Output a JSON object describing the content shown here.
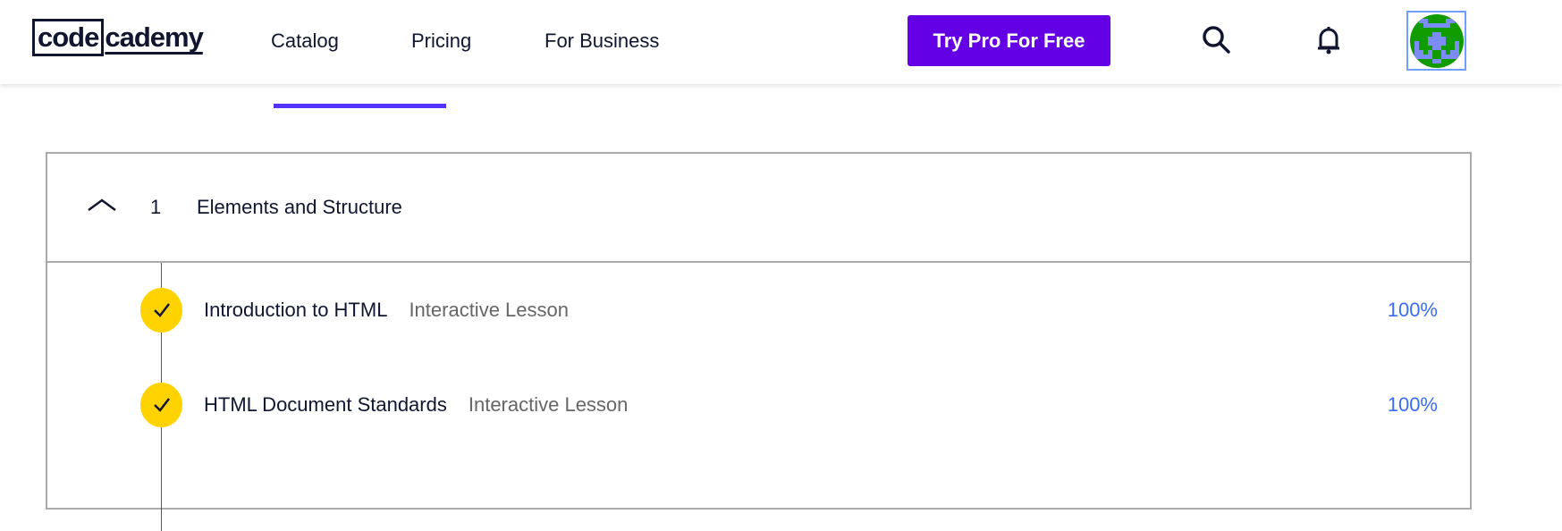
{
  "header": {
    "logo": {
      "part1": "code",
      "part2": "cademy"
    },
    "nav": [
      {
        "label": "Catalog"
      },
      {
        "label": "Pricing"
      },
      {
        "label": "For Business"
      }
    ],
    "cta_label": "Try Pro For Free",
    "icons": [
      "search-icon",
      "bell-icon"
    ],
    "colors": {
      "cta": "#6400e4",
      "accent": "#5533ff"
    }
  },
  "syllabus": {
    "section": {
      "number": "1",
      "title": "Elements and Structure",
      "expanded": true
    },
    "lessons": [
      {
        "title": "Introduction to HTML",
        "type": "Interactive Lesson",
        "progress": "100%",
        "completed": true
      },
      {
        "title": "HTML Document Standards",
        "type": "Interactive Lesson",
        "progress": "100%",
        "completed": true
      }
    ]
  }
}
